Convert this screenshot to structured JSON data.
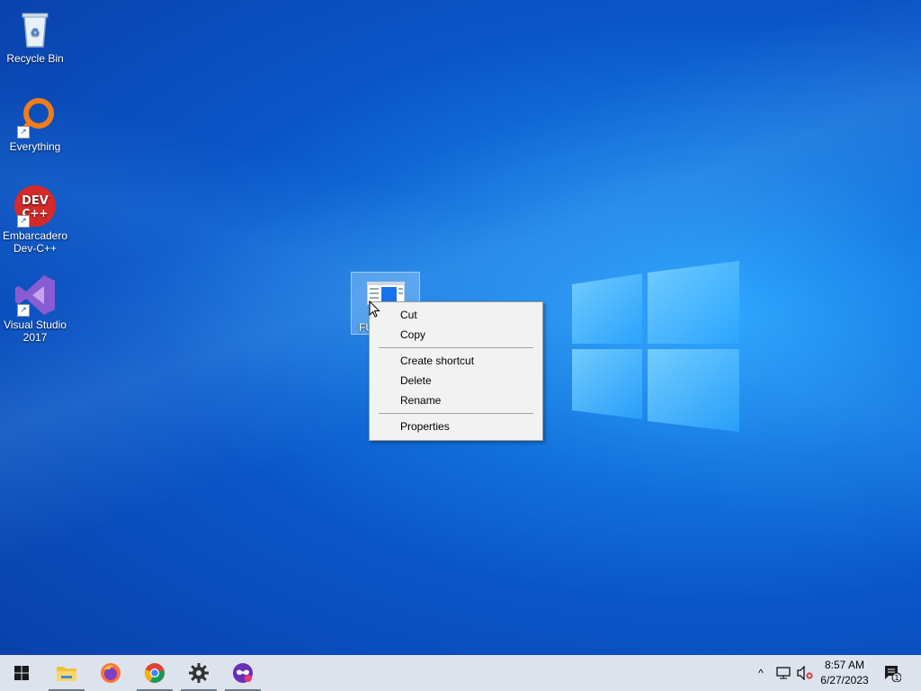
{
  "desktop": {
    "icons": [
      {
        "label": "Recycle Bin"
      },
      {
        "label": "Everything"
      },
      {
        "label_line1": "Embarcadero",
        "label_line2": "Dev-C++"
      },
      {
        "label_line1": "Visual Studio",
        "label_line2": "2017"
      }
    ],
    "selected_file": {
      "label_visible": "FU"
    }
  },
  "context_menu": {
    "items": [
      "Cut",
      "Copy",
      "Create shortcut",
      "Delete",
      "Rename",
      "Properties"
    ]
  },
  "taskbar": {
    "start_icon": "windows-start-icon",
    "apps": [
      "file-explorer-icon",
      "firefox-icon",
      "chrome-icon",
      "settings-gear-icon",
      "app-mask-icon"
    ],
    "tray": {
      "chevron": "^",
      "clock_time": "8:57 AM",
      "clock_date": "6/27/2023",
      "notification_count": "1"
    }
  },
  "colors": {
    "taskbar_bg": "#dce3ec",
    "menu_bg": "#f2f2f2",
    "desktop_accent": "#1477e0"
  }
}
